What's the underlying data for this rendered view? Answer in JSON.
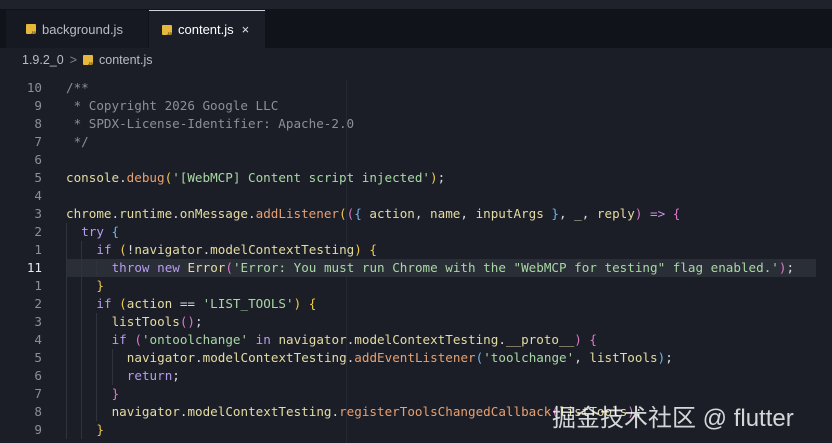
{
  "tabs": [
    {
      "label": "background.js",
      "icon": "js-file-icon",
      "active": false
    },
    {
      "label": "content.js",
      "icon": "js-file-icon",
      "active": true,
      "close": "×"
    }
  ],
  "breadcrumb": {
    "folder": "1.9.2_0",
    "separator": ">",
    "file": "content.js"
  },
  "watermark": "掘金技术社区 @ flutter",
  "editor": {
    "current_line": 11,
    "lines": [
      {
        "n": "10",
        "indent": 0,
        "tokens": [
          [
            "/**",
            "com"
          ]
        ]
      },
      {
        "n": "9",
        "indent": 0,
        "tokens": [
          [
            " * Copyright 2026 Google LLC",
            "com"
          ]
        ]
      },
      {
        "n": "8",
        "indent": 0,
        "tokens": [
          [
            " * SPDX-License-Identifier: Apache-2.0",
            "com"
          ]
        ]
      },
      {
        "n": "7",
        "indent": 0,
        "tokens": [
          [
            " */",
            "com"
          ]
        ]
      },
      {
        "n": "6",
        "indent": 0,
        "tokens": []
      },
      {
        "n": "5",
        "indent": 0,
        "tokens": [
          [
            "console",
            "id"
          ],
          [
            ".",
            "p"
          ],
          [
            "debug",
            "fn"
          ],
          [
            "(",
            "b1"
          ],
          [
            "'[WebMCP] Content script injected'",
            "str"
          ],
          [
            "",
            "p"
          ],
          [
            ")",
            "b1"
          ],
          [
            ";",
            "p"
          ]
        ]
      },
      {
        "n": "4",
        "indent": 0,
        "tokens": []
      },
      {
        "n": "3",
        "indent": 0,
        "tokens": [
          [
            "chrome",
            "id"
          ],
          [
            ".",
            "p"
          ],
          [
            "runtime",
            "id"
          ],
          [
            ".",
            "p"
          ],
          [
            "onMessage",
            "id"
          ],
          [
            ".",
            "p"
          ],
          [
            "addListener",
            "fn"
          ],
          [
            "(",
            "b1"
          ],
          [
            "(",
            "b3"
          ],
          [
            "{ ",
            "b2"
          ],
          [
            "action",
            "id"
          ],
          [
            ", ",
            "p"
          ],
          [
            "name",
            "id"
          ],
          [
            ", ",
            "p"
          ],
          [
            "inputArgs",
            "id"
          ],
          [
            " }",
            "b2"
          ],
          [
            ", ",
            "p"
          ],
          [
            "_",
            "id"
          ],
          [
            ", ",
            "p"
          ],
          [
            "reply",
            "id"
          ],
          [
            ")",
            "b3"
          ],
          [
            " => ",
            "op"
          ],
          [
            "{",
            "b3"
          ]
        ]
      },
      {
        "n": "2",
        "indent": 1,
        "tokens": [
          [
            "try",
            "kw"
          ],
          [
            " {",
            "b2"
          ]
        ]
      },
      {
        "n": "1",
        "indent": 2,
        "tokens": [
          [
            "if",
            "kw"
          ],
          [
            " (",
            "b1"
          ],
          [
            "!",
            "p"
          ],
          [
            "navigator",
            "id"
          ],
          [
            ".",
            "p"
          ],
          [
            "modelContextTesting",
            "id"
          ],
          [
            ")",
            "b1"
          ],
          [
            " {",
            "b1"
          ]
        ]
      },
      {
        "n": "11",
        "indent": 3,
        "tokens": [
          [
            "throw",
            "kw"
          ],
          [
            " ",
            "p"
          ],
          [
            "new",
            "kw"
          ],
          [
            " ",
            "p"
          ],
          [
            "Error",
            "id"
          ],
          [
            "(",
            "b3"
          ],
          [
            "'Error: You must run Chrome with the \"WebMCP for testing\" flag enabled.'",
            "str"
          ],
          [
            ")",
            "b3"
          ],
          [
            ";",
            "p"
          ]
        ]
      },
      {
        "n": "1",
        "indent": 2,
        "tokens": [
          [
            "}",
            "b1"
          ]
        ]
      },
      {
        "n": "2",
        "indent": 2,
        "tokens": [
          [
            "if",
            "kw"
          ],
          [
            " (",
            "b1"
          ],
          [
            "action",
            "id"
          ],
          [
            " == ",
            "p"
          ],
          [
            "'LIST_TOOLS'",
            "str"
          ],
          [
            ")",
            "b1"
          ],
          [
            " {",
            "b1"
          ]
        ]
      },
      {
        "n": "3",
        "indent": 3,
        "tokens": [
          [
            "listTools",
            "id"
          ],
          [
            "()",
            "b3"
          ],
          [
            ";",
            "p"
          ]
        ]
      },
      {
        "n": "4",
        "indent": 3,
        "tokens": [
          [
            "if",
            "kw"
          ],
          [
            " (",
            "b3"
          ],
          [
            "'ontoolchange'",
            "str"
          ],
          [
            " in ",
            "kw"
          ],
          [
            "navigator",
            "id"
          ],
          [
            ".",
            "p"
          ],
          [
            "modelContextTesting",
            "id"
          ],
          [
            ".",
            "p"
          ],
          [
            "__proto__",
            "id"
          ],
          [
            ")",
            "b3"
          ],
          [
            " {",
            "b3"
          ]
        ]
      },
      {
        "n": "5",
        "indent": 4,
        "tokens": [
          [
            "navigator",
            "id"
          ],
          [
            ".",
            "p"
          ],
          [
            "modelContextTesting",
            "id"
          ],
          [
            ".",
            "p"
          ],
          [
            "addEventListener",
            "fn"
          ],
          [
            "(",
            "b2"
          ],
          [
            "'toolchange'",
            "str"
          ],
          [
            ", ",
            "p"
          ],
          [
            "listTools",
            "id"
          ],
          [
            ")",
            "b2"
          ],
          [
            ";",
            "p"
          ]
        ]
      },
      {
        "n": "6",
        "indent": 4,
        "tokens": [
          [
            "return",
            "kw"
          ],
          [
            ";",
            "p"
          ]
        ]
      },
      {
        "n": "7",
        "indent": 3,
        "tokens": [
          [
            "}",
            "b3"
          ]
        ]
      },
      {
        "n": "8",
        "indent": 3,
        "tokens": [
          [
            "navigator",
            "id"
          ],
          [
            ".",
            "p"
          ],
          [
            "modelContextTesting",
            "id"
          ],
          [
            ".",
            "p"
          ],
          [
            "registerToolsChangedCallback",
            "fn"
          ],
          [
            "(",
            "b3"
          ],
          [
            "listTools",
            "id"
          ],
          [
            ")",
            "b3"
          ],
          [
            ";",
            "p"
          ]
        ]
      },
      {
        "n": "9",
        "indent": 2,
        "tokens": [
          [
            "}",
            "b1"
          ]
        ]
      }
    ]
  }
}
